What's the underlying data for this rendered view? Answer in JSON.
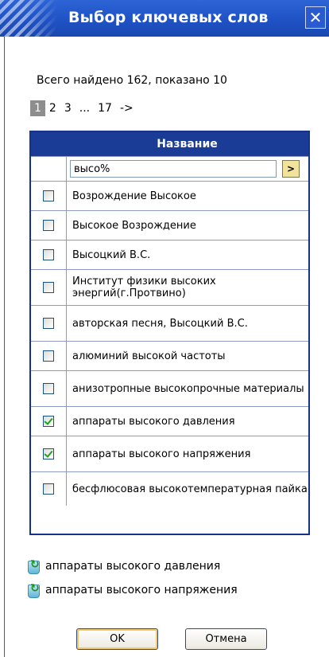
{
  "window": {
    "title": "Выбор ключевых слов"
  },
  "summary": "Всего найдено 162, показано 10",
  "pager": {
    "pages": [
      "1",
      "2",
      "3",
      "...",
      "17",
      "->"
    ],
    "current": "1"
  },
  "table": {
    "header": "Название",
    "search_value": "высо%",
    "search_button": ">",
    "rows": [
      {
        "label": "Возрождение Высокое",
        "checked": false
      },
      {
        "label": "Высокое Возрождение",
        "checked": false
      },
      {
        "label": "Высоцкий В.С.",
        "checked": false
      },
      {
        "label": "Институт физики высоких энергий(г.Протвино)",
        "checked": false
      },
      {
        "label": "авторская песня, Высоцкий В.С.",
        "checked": false
      },
      {
        "label": "алюминий высокой частоты",
        "checked": false
      },
      {
        "label": "анизотропные высокопрочные материалы",
        "checked": false
      },
      {
        "label": "аппараты высокого давления",
        "checked": true
      },
      {
        "label": "аппараты высокого напряжения",
        "checked": true
      },
      {
        "label": "бесфлюсовая высокотемпературная пайка",
        "checked": false
      }
    ]
  },
  "selected_items": [
    {
      "label": "аппараты высокого давления",
      "icon": "recycle-bin-icon"
    },
    {
      "label": "аппараты высокого напряжения",
      "icon": "recycle-bin-icon"
    }
  ],
  "buttons": {
    "ok": "OK",
    "cancel": "Отмена"
  },
  "colors": {
    "titlebar": "#2d64d6",
    "table_header": "#1a3c96",
    "check": "#21a121"
  }
}
